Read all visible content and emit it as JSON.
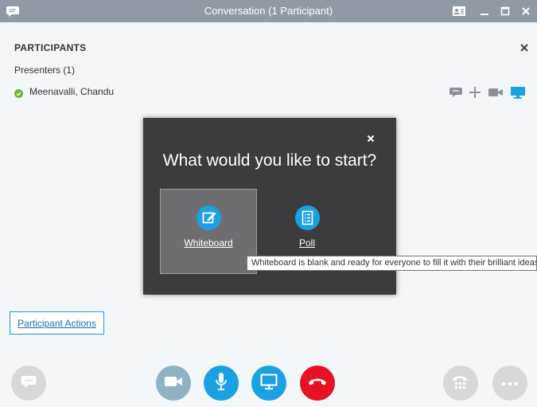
{
  "window": {
    "title": "Conversation (1 Participant)",
    "icons": [
      "chat-bubble-icon",
      "contact-card-icon",
      "minimize-icon",
      "maximize-icon",
      "close-icon"
    ]
  },
  "participants": {
    "heading": "PARTICIPANTS",
    "group_label": "Presenters (1)",
    "members": [
      {
        "name": "Meenavalli, Chandu",
        "status": "available",
        "status_color": "#6fb52c"
      }
    ],
    "row_icons": [
      "im-icon",
      "add-icon",
      "video-icon",
      "present-icon"
    ],
    "actions_label": "Participant Actions"
  },
  "dialog": {
    "heading": "What would you like to start?",
    "options": [
      {
        "label": "Whiteboard",
        "icon": "whiteboard-icon",
        "selected": true
      },
      {
        "label": "Poll",
        "icon": "poll-icon",
        "selected": false
      }
    ]
  },
  "tooltip": {
    "text": "Whiteboard is blank and ready for everyone to fill it with their brilliant ideas."
  },
  "controls": [
    {
      "name": "chat",
      "icon": "chat-icon",
      "color": "#d5d9dc"
    },
    {
      "name": "video",
      "icon": "video-camera-icon",
      "color": "#8fb3c4"
    },
    {
      "name": "mic",
      "icon": "microphone-icon",
      "color": "#1ba1e2"
    },
    {
      "name": "present",
      "icon": "monitor-icon",
      "color": "#1ba1e2"
    },
    {
      "name": "hang-up",
      "icon": "phone-hangup-icon",
      "color": "#e81123"
    },
    {
      "name": "call-controls",
      "icon": "dialpad-icon",
      "color": "#d5d9dc"
    },
    {
      "name": "more",
      "icon": "more-options-icon",
      "color": "#d5d9dc"
    }
  ],
  "colors": {
    "titlebar": "#8f9aa4",
    "accent": "#1ba1e2",
    "dialog_bg": "#3c3c3e",
    "hangup": "#e81123",
    "presence_available": "#6fb52c"
  }
}
